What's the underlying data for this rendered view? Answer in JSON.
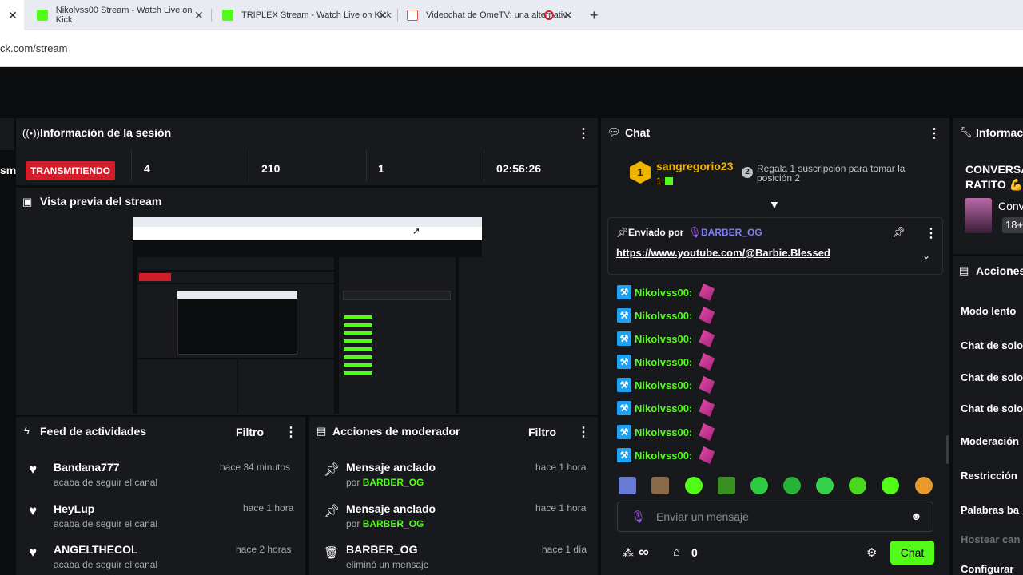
{
  "browser": {
    "tabs": [
      {
        "title": "Nikolvss00 Stream - Watch Live on Kick"
      },
      {
        "title": "TRIPLEX Stream - Watch Live on Kick"
      },
      {
        "title": "Videochat de OmeTV: una alternativ"
      }
    ],
    "url": "ck.com/stream"
  },
  "session": {
    "title": "Información de la sesión",
    "left_cut": "sm",
    "live_label": "TRANSMITIENDO",
    "stats": [
      "4",
      "210",
      "1",
      "02:56:26"
    ]
  },
  "preview": {
    "title": "Vista previa del stream"
  },
  "feed": {
    "title": "Feed de actividades",
    "filter": "Filtro",
    "items": [
      {
        "name": "Bandana777",
        "sub": "acaba de seguir el canal",
        "time": "hace 34 minutos"
      },
      {
        "name": "HeyLup",
        "sub": "acaba de seguir el canal",
        "time": "hace 1 hora"
      },
      {
        "name": "ANGELTHECOL",
        "sub": "acaba de seguir el canal",
        "time": "hace 2 horas"
      }
    ]
  },
  "mod": {
    "title": "Acciones de moderador",
    "filter": "Filtro",
    "items": [
      {
        "name": "Mensaje anclado",
        "sub_prefix": "por",
        "sub_user": "BARBER_OG",
        "time": "hace 1 hora"
      },
      {
        "name": "Mensaje anclado",
        "sub_prefix": "por",
        "sub_user": "BARBER_OG",
        "time": "hace 1 hora"
      },
      {
        "name": "BARBER_OG",
        "sub_prefix": "eliminó un mensaje",
        "sub_user": "",
        "time": "hace 1 día"
      }
    ]
  },
  "chat": {
    "title": "Chat",
    "top_gifter": {
      "rank": "1",
      "name": "sangregorio23",
      "count": "1"
    },
    "gift_rank": "2",
    "gift_text": "Regala 1 suscripción para tomar la posición 2",
    "pinned_label": "Enviado por",
    "pinned_user": "BARBER_OG",
    "pinned_link": "https://www.youtube.com/@Barbie.Blessed",
    "messages": [
      "Nikolvss00:",
      "Nikolvss00:",
      "Nikolvss00:",
      "Nikolvss00:",
      "Nikolvss00:",
      "Nikolvss00:",
      "Nikolvss00:",
      "Nikolvss00:"
    ],
    "input_placeholder": "Enviar un mensaje",
    "points": "∞",
    "store_count": "0",
    "send_label": "Chat"
  },
  "right": {
    "info_title": "Informac",
    "conv_line1": "CONVERSA",
    "conv_line2": "RATITO 💪",
    "conv_short": "Conv",
    "age": "18+",
    "actions_title": "Acciones",
    "actions": [
      "Modo lento",
      "Chat de solo",
      "Chat de solo",
      "Chat de solo",
      "Moderación",
      "Restricción",
      "Palabras ba",
      "Hostear can",
      "Configurar"
    ]
  },
  "colors": {
    "accent": "#53fc18",
    "live": "#d21e2a",
    "panel": "#18191c",
    "mod": "#1da1f2",
    "pink": "#e94ba8"
  }
}
